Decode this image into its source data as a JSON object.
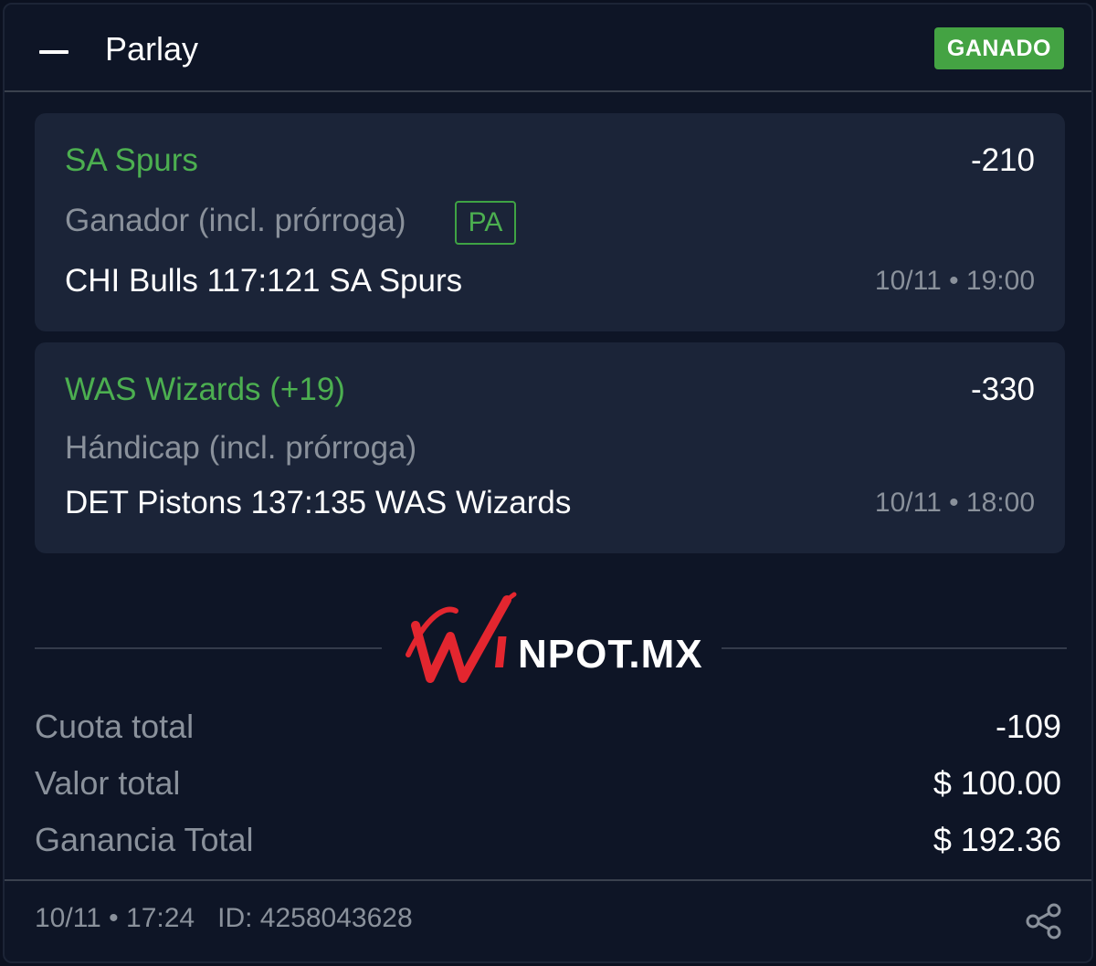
{
  "header": {
    "title": "Parlay",
    "status": "GANADO",
    "collapse_icon": "minus-icon"
  },
  "selections": [
    {
      "pick": "SA Spurs",
      "odds": "-210",
      "market": "Ganador (incl. prórroga)",
      "badge": "PA",
      "match": "CHI Bulls 117:121 SA Spurs",
      "datetime": "10/11 • 19:00"
    },
    {
      "pick": "WAS Wizards (+19)",
      "odds": "-330",
      "market": "Hándicap (incl. prórroga)",
      "match": "DET Pistons 137:135 WAS Wizards",
      "datetime": "10/11 • 18:00"
    }
  ],
  "logo": {
    "text_red": "W",
    "text_white": "NPOT.MX",
    "brand_red": "#e3262f"
  },
  "totals": {
    "odds_label": "Cuota total",
    "odds_value": "-109",
    "stake_label": "Valor total",
    "stake_value": "$ 100.00",
    "win_label": "Ganancia Total",
    "win_value": "$ 192.36"
  },
  "footer": {
    "timestamp": "10/11 • 17:24",
    "id_text": "ID: 4258043628",
    "share_icon": "share-icon"
  },
  "colors": {
    "background": "#0e1526",
    "selection_bg": "#1b2438",
    "accent_green": "#4caf50",
    "status_green": "#44a343",
    "muted_text": "#8a919b"
  }
}
